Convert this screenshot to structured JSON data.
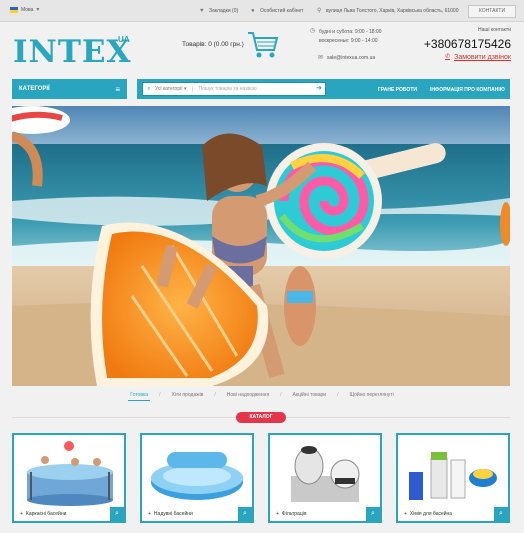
{
  "topbar": {
    "lang": "Мова",
    "wishlist": "Закладки (0)",
    "account": "Особистий кабінет",
    "address": "вулиця Льва Толстого, Харків, Харківська область, 61000",
    "contacts_btn": "КОНТАКТИ"
  },
  "header": {
    "logo": "INTEX",
    "logo_sup": "UA",
    "cart": "Товарів: 0 (0.00 грн.)",
    "hours_weekdays": "будні и субота: 9:00 - 18:00",
    "hours_sunday": "воскресенье: 9:00 - 14:00",
    "email": "sale@intexua.com.ua",
    "our_contacts": "Наші контакти",
    "phone": "+380678175426",
    "callback": "Замовити дзвінок"
  },
  "nav": {
    "categories": "КАТЕГОРІЇ",
    "search_category": "Усі категорії",
    "search_placeholder": "Пошук товарів за назвою",
    "link1": "ГРАНЕ РОБОТИ",
    "link2": "ІНФОРМАЦІЯ ПРО КОМПАНІЮ"
  },
  "tabs": [
    "Готовка",
    "Хіти продажів",
    "Нові надходження",
    "Акційні товари",
    "Щойно переглянуті"
  ],
  "catalog_badge": "КАТАЛОГ",
  "products": [
    {
      "label": "Каркасні басейни",
      "icon": "plus-icon"
    },
    {
      "label": "Надувні басейни",
      "icon": "plus-icon"
    },
    {
      "label": "Фільтрація",
      "icon": "plus-icon"
    },
    {
      "label": "Хімія для басейна",
      "icon": "plus-icon"
    }
  ],
  "colors": {
    "accent": "#2aa5bf",
    "badge": "#e3364b",
    "callback": "#d9322d"
  }
}
